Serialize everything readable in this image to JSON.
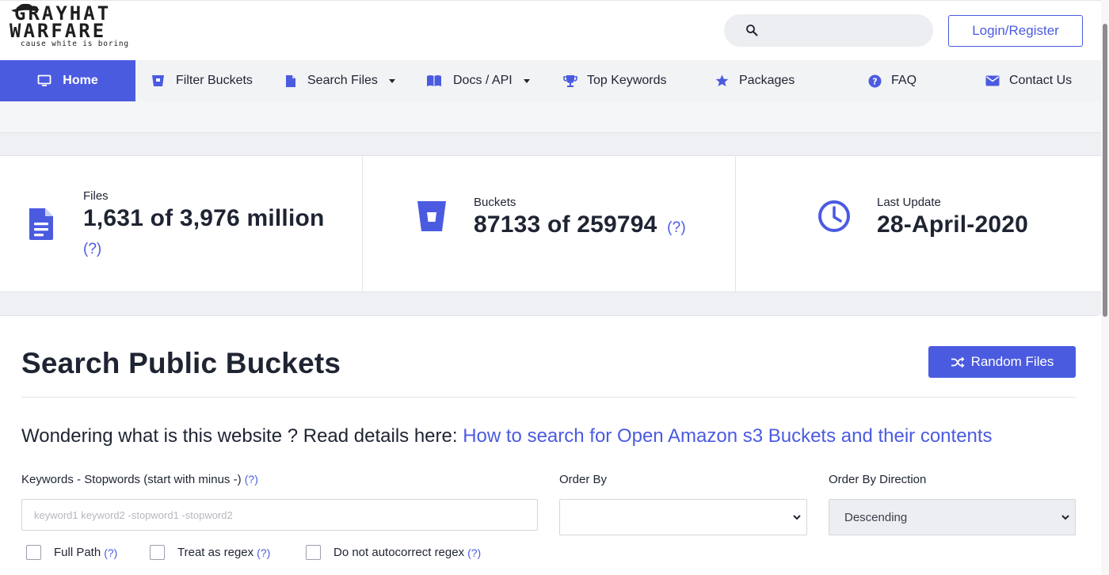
{
  "header": {
    "logo": {
      "line1": "GRAYHAT",
      "line2": "WARFARE",
      "tagline": "cause white is boring"
    },
    "search": {
      "placeholder": "",
      "value": ""
    },
    "login_label": "Login/Register"
  },
  "nav": {
    "items": [
      {
        "label": "Home",
        "icon": "monitor-icon",
        "active": true
      },
      {
        "label": "Filter Buckets",
        "icon": "bucket-icon",
        "dropdown": true
      },
      {
        "label": "Search Files",
        "icon": "file-icon",
        "dropdown": true
      },
      {
        "label": "Docs / API",
        "icon": "book-icon",
        "dropdown": true
      },
      {
        "label": "Top Keywords",
        "icon": "trophy-icon"
      },
      {
        "label": "Packages",
        "icon": "star-icon"
      },
      {
        "label": "FAQ",
        "icon": "question-circle-icon"
      },
      {
        "label": "Contact Us",
        "icon": "envelope-icon"
      }
    ]
  },
  "stats": {
    "files": {
      "label": "Files",
      "value": "1,631 of 3,976 million",
      "help": "(?)",
      "icon": "file-text-icon"
    },
    "buckets": {
      "label": "Buckets",
      "value": "87133 of 259794",
      "help": "(?)",
      "icon": "bucket-icon"
    },
    "last_update": {
      "label": "Last Update",
      "value": "28-April-2020",
      "icon": "clock-icon"
    }
  },
  "main": {
    "title": "Search Public Buckets",
    "random_label": "Random Files",
    "intro_text": "Wondering what is this website ? Read details here: ",
    "intro_link": "How to search for Open Amazon s3 Buckets and their contents",
    "keywords": {
      "label": "Keywords - Stopwords (start with minus -)",
      "help": "(?)",
      "placeholder": "keyword1 keyword2 -stopword1 -stopword2",
      "value": ""
    },
    "order_by": {
      "label": "Order By",
      "value": ""
    },
    "order_dir": {
      "label": "Order By Direction",
      "value": "Descending"
    },
    "checkboxes": [
      {
        "label": "Full Path",
        "help": "(?)",
        "checked": false
      },
      {
        "label": "Treat as regex",
        "help": "(?)",
        "checked": false
      },
      {
        "label": "Do not autocorrect regex",
        "help": "(?)",
        "checked": false
      }
    ]
  },
  "colors": {
    "accent": "#4b5be0",
    "text": "#1e2432",
    "nav_bg": "#f2f3f5",
    "band_bg": "#eef0f3"
  }
}
